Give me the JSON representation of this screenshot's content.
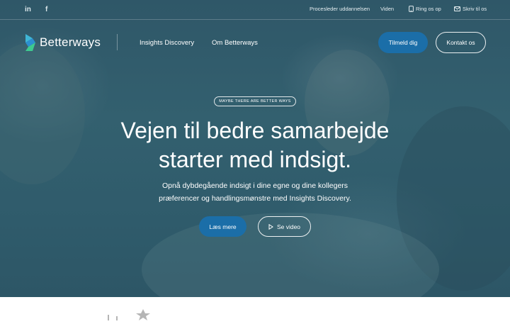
{
  "topbar": {
    "social_icons": [
      "linkedin-icon",
      "facebook-icon"
    ],
    "links": [
      {
        "label": "Procesleder uddannelsen"
      },
      {
        "label": "Viden"
      },
      {
        "label": "Ring os op",
        "icon": "phone-icon"
      },
      {
        "label": "Skriv til os",
        "icon": "mail-icon"
      }
    ]
  },
  "header": {
    "logo_text": "Betterways",
    "nav": [
      "Insights Discovery",
      "Om Betterways"
    ],
    "signup_label": "Tilmeld dig",
    "contact_label": "Kontakt os"
  },
  "hero": {
    "badge": "MAYBE THERE ARE BETTER WAYS",
    "headline_line1": "Vejen til bedre samarbejde",
    "headline_line2": "starter med indsigt.",
    "subtitle_line1": "Opnå dybdegående indsigt i dine egne og dine kollegers",
    "subtitle_line2": "præferencer og handlingsmønstre med Insights Discovery.",
    "read_more_label": "Læs mere",
    "video_label": "Se video"
  },
  "colors": {
    "hero_overlay": "#2f5a6b",
    "primary_button": "#1b6ea8",
    "text": "#ffffff"
  }
}
